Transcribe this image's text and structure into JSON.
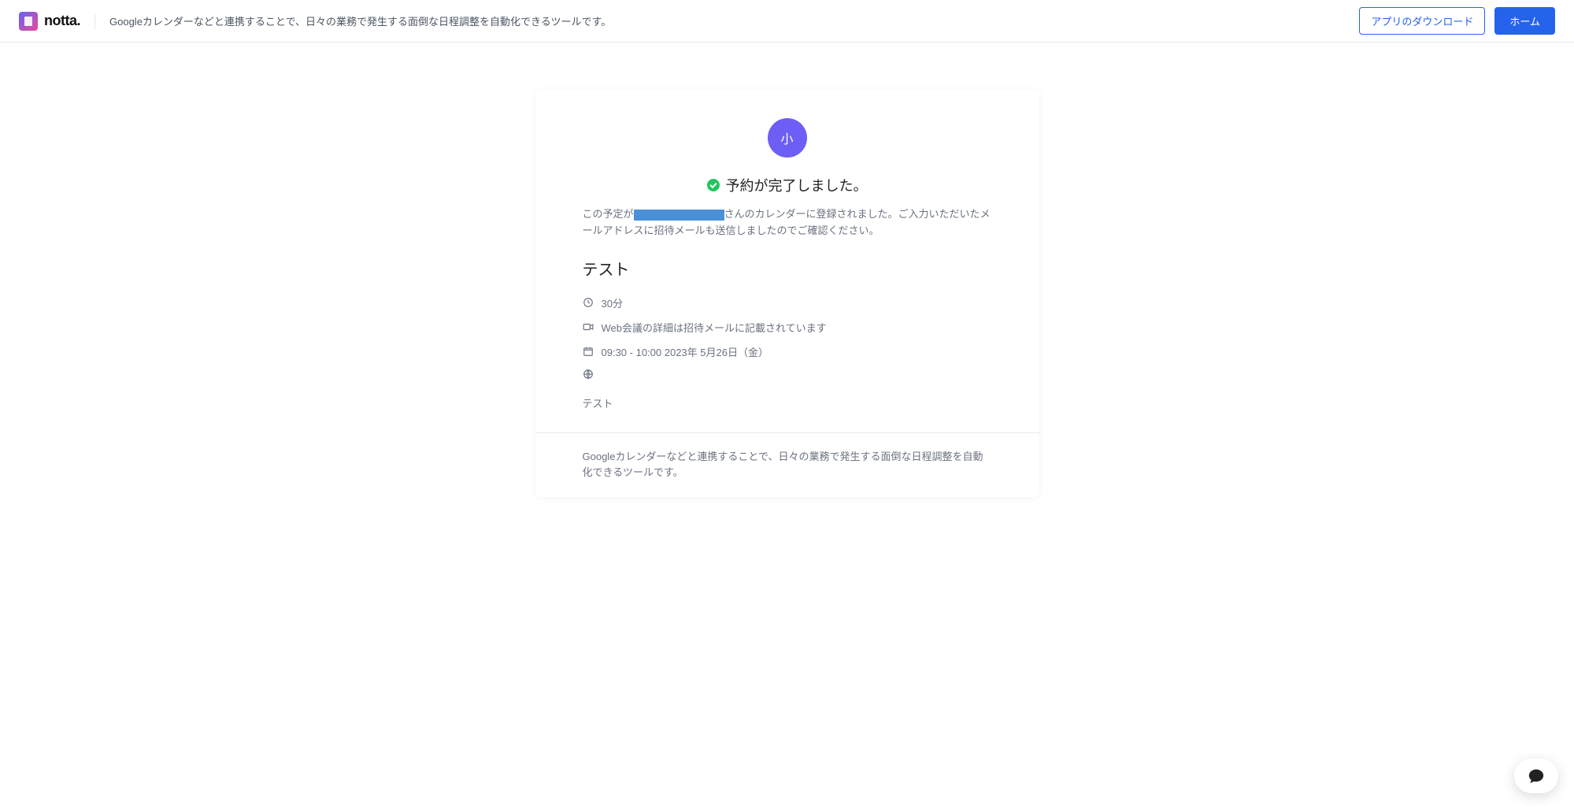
{
  "header": {
    "logo_text": "notta.",
    "description": "Googleカレンダーなどと連携することで、日々の業務で発生する面倒な日程調整を自動化できるツールです。",
    "download_button": "アプリのダウンロード",
    "home_button": "ホーム"
  },
  "confirmation": {
    "avatar_initial": "小",
    "success_title": "予約が完了しました。",
    "confirm_prefix": "この予定が",
    "confirm_suffix": "さんのカレンダーに登録されました。ご入力いただいたメールアドレスに招待メールも送信しましたのでご確認ください。",
    "event_title": "テスト",
    "duration": "30分",
    "meeting_info": "Web会議の詳細は招待メールに記載されています",
    "datetime": "09:30 - 10:00 2023年 5月26日（金）",
    "note": "テスト"
  },
  "footer": {
    "text": "Googleカレンダーなどと連携することで、日々の業務で発生する面倒な日程調整を自動化できるツールです。"
  }
}
